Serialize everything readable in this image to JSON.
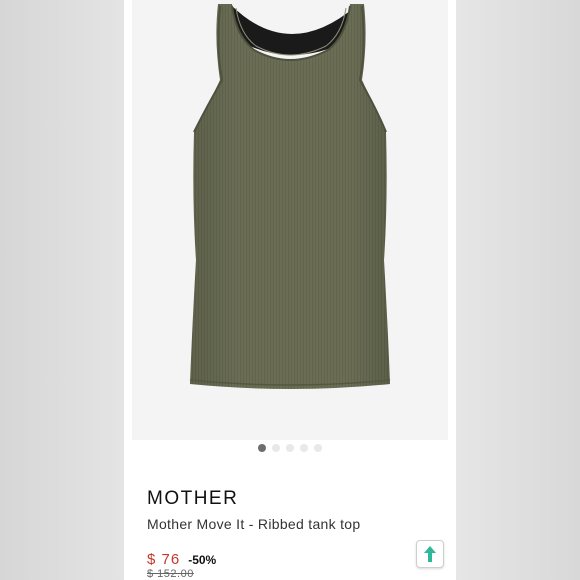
{
  "product": {
    "brand": "MOTHER",
    "name": "Mother Move It - Ribbed tank top",
    "price": "$ 76",
    "discount": "-50%",
    "original_price": "$ 152.00",
    "color_swatch": "#6b6e55"
  },
  "gallery": {
    "total_images": 5,
    "active_index": 0
  },
  "colors": {
    "price_red": "#c0392b",
    "share_green": "#2eb89a"
  },
  "icons": {
    "share": "share-arrow-icon"
  }
}
